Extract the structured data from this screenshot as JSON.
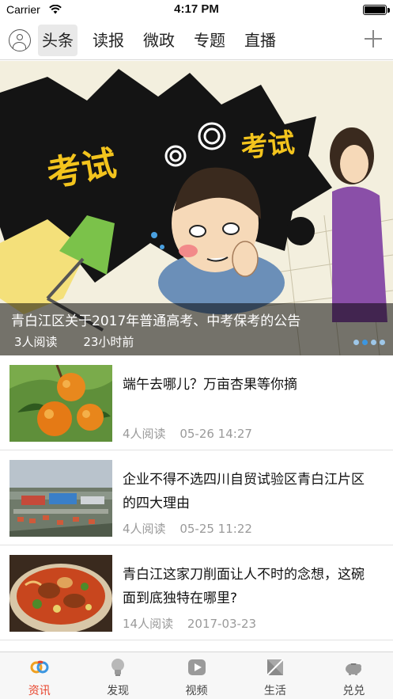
{
  "status_bar": {
    "carrier": "Carrier",
    "time": "4:17 PM",
    "battery_level": 1.0
  },
  "nav": {
    "tabs": [
      {
        "label": "头条",
        "active": true
      },
      {
        "label": "读报",
        "active": false
      },
      {
        "label": "微政",
        "active": false
      },
      {
        "label": "专题",
        "active": false
      },
      {
        "label": "直播",
        "active": false
      }
    ],
    "left_icon": "user-avatar-icon",
    "right_icon": "plus-icon"
  },
  "banner": {
    "image_text_left": "考试",
    "image_text_right": "考试",
    "title": "青白江区关于2017年普通高考、中考保考的公告",
    "reads": "3人阅读",
    "time": "23小时前",
    "page_count": 4,
    "active_page": 1
  },
  "news": [
    {
      "title": "端午去哪儿？万亩杏果等你摘",
      "reads": "4人阅读",
      "date": "05-26 14:27",
      "thumb": "apricots"
    },
    {
      "title": "企业不得不选四川自贸试验区青白江片区的四大理由",
      "reads": "4人阅读",
      "date": "05-25 11:22",
      "thumb": "industrial-park"
    },
    {
      "title": "青白江这家刀削面让人不时的念想，这碗面到底独特在哪里?",
      "reads": "14人阅读",
      "date": "2017-03-23",
      "thumb": "noodle-bowl"
    }
  ],
  "tabbar": [
    {
      "label": "资讯",
      "icon": "news-icon",
      "active": true
    },
    {
      "label": "发现",
      "icon": "lightbulb-icon",
      "active": false
    },
    {
      "label": "视频",
      "icon": "play-icon",
      "active": false
    },
    {
      "label": "生活",
      "icon": "life-icon",
      "active": false
    },
    {
      "label": "兑兑",
      "icon": "piggy-bank-icon",
      "active": false
    }
  ],
  "colors": {
    "accent": "#e8432b",
    "dot_active": "#3b96e0",
    "meta_gray": "#9a9a9a"
  }
}
